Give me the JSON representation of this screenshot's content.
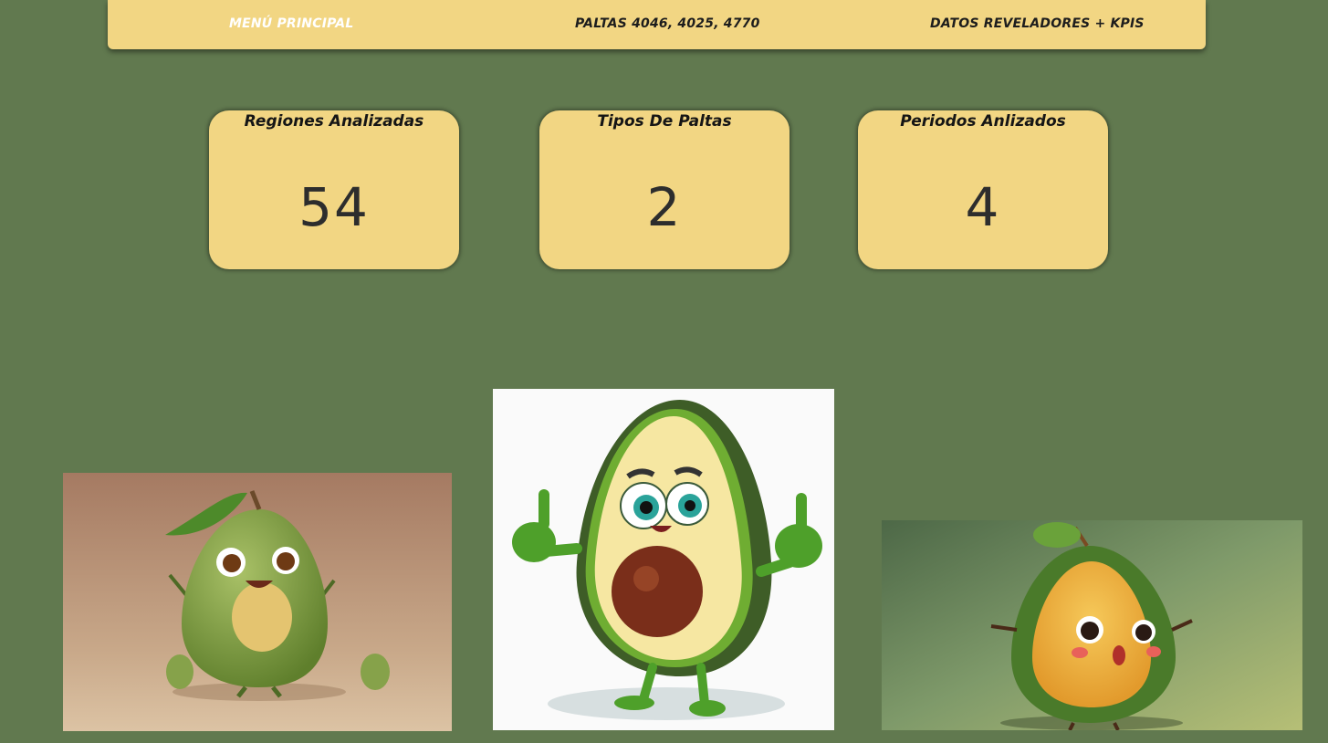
{
  "nav": {
    "items": [
      {
        "label": "MENÚ PRINCIPAL",
        "active": true
      },
      {
        "label": "PALTAS 4046, 4025, 4770",
        "active": false
      },
      {
        "label": "DATOS REVELADORES + KPIS",
        "active": false
      }
    ]
  },
  "kpis": [
    {
      "title": "Regiones Analizadas",
      "value": "54"
    },
    {
      "title": "Tipos De Paltas",
      "value": "2"
    },
    {
      "title": "Periodos Anlizados",
      "value": "4"
    }
  ],
  "images": [
    {
      "name": "avocado-waving-image",
      "subject": "cartoon avocado character waving"
    },
    {
      "name": "avocado-thumbs-up-image",
      "subject": "cartoon avocado character giving thumbs up"
    },
    {
      "name": "avocado-surprised-image",
      "subject": "cartoon avocado character surprised"
    }
  ],
  "colors": {
    "background": "#61794f",
    "panel": "#f2d683",
    "active_text": "#ffffff",
    "text": "#1d1d1d"
  }
}
